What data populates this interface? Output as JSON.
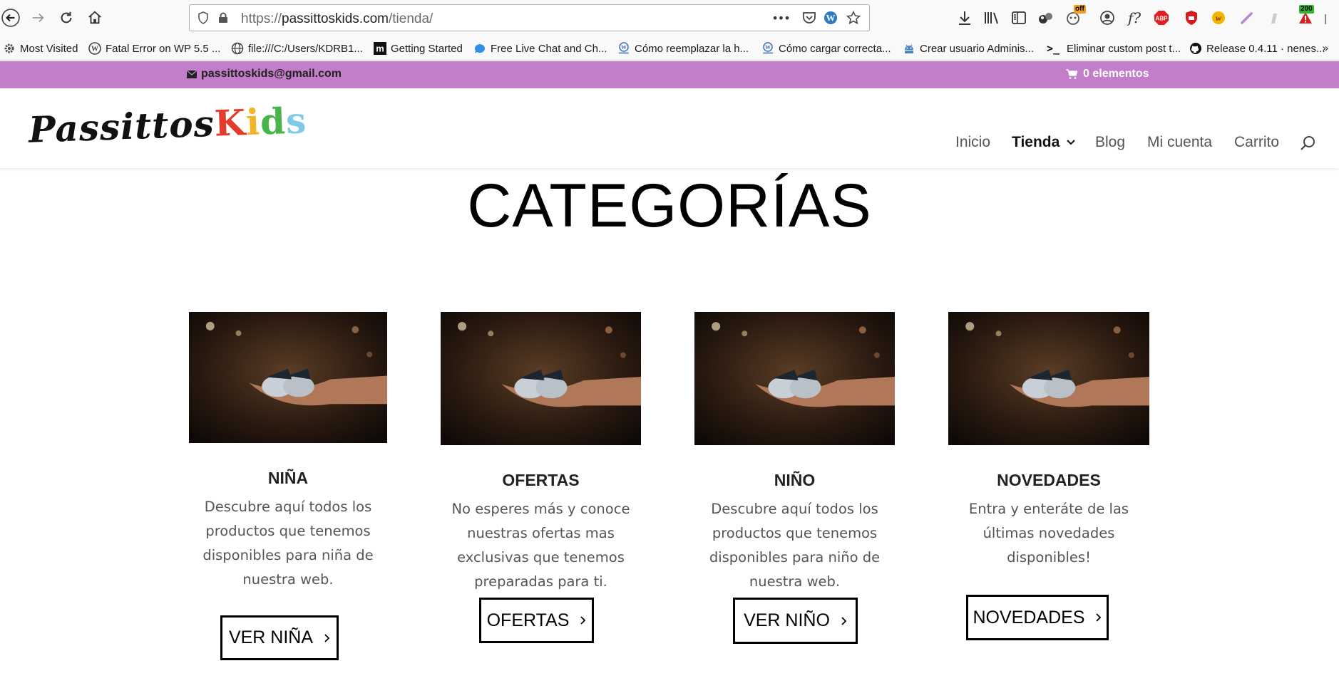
{
  "browser": {
    "url_scheme": "https://",
    "url_host": "passittoskids.com",
    "url_path": "/tienda/",
    "page_actions": "•••",
    "extension_badges": {
      "off": "off",
      "count": "200"
    },
    "bookmarks": [
      {
        "label": "Most Visited",
        "icon": "gear-icon"
      },
      {
        "label": "Fatal Error on WP 5.5 ...",
        "icon": "wordpress-icon"
      },
      {
        "label": "file:///C:/Users/KDRB1...",
        "icon": "globe-icon"
      },
      {
        "label": "Getting Started",
        "icon": "m-icon"
      },
      {
        "label": "Free Live Chat and Ch...",
        "icon": "chat-icon"
      },
      {
        "label": "Cómo reemplazar la h...",
        "icon": "wp-forum-icon"
      },
      {
        "label": "Cómo cargar correcta...",
        "icon": "wp-forum-icon"
      },
      {
        "label": "Crear usuario Adminis...",
        "icon": "android-icon"
      },
      {
        "label": "Eliminar custom post t...",
        "icon": "terminal-icon"
      },
      {
        "label": "Release 0.4.11 · nenes...",
        "icon": "github-icon"
      }
    ]
  },
  "site": {
    "email": "passittoskids@gmail.com",
    "cart_label": "0 elementos",
    "logo": {
      "part1": "Passittos",
      "k": "K",
      "i": "i",
      "d": "d",
      "s": "s"
    },
    "nav": {
      "inicio": "Inicio",
      "tienda": "Tienda",
      "blog": "Blog",
      "mi_cuenta": "Mi cuenta",
      "carrito": "Carrito"
    },
    "colors": {
      "topbar": "#c27ec8",
      "text": "#333333"
    }
  },
  "main": {
    "title": "CATEGORÍAS",
    "categories": [
      {
        "name": "NIÑA",
        "desc_lines": [
          "Descubre aquí todos los",
          "productos que tenemos",
          "disponibles para niña de",
          "nuestra web."
        ],
        "button": "VER NIÑA"
      },
      {
        "name": "OFERTAS",
        "desc_lines": [
          "No esperes más y conoce",
          "nuestras ofertas mas",
          "exclusivas que tenemos",
          "preparadas para ti."
        ],
        "button": "OFERTAS"
      },
      {
        "name": "NIÑO",
        "desc_lines": [
          "Descubre aquí todos los",
          "productos que tenemos",
          "disponibles para niño de",
          "nuestra web."
        ],
        "button": "VER NIÑO"
      },
      {
        "name": "NOVEDADES",
        "desc_lines": [
          "Entra y enteráte de las",
          "últimas novedades",
          "disponibles!"
        ],
        "button": "NOVEDADES"
      }
    ]
  }
}
